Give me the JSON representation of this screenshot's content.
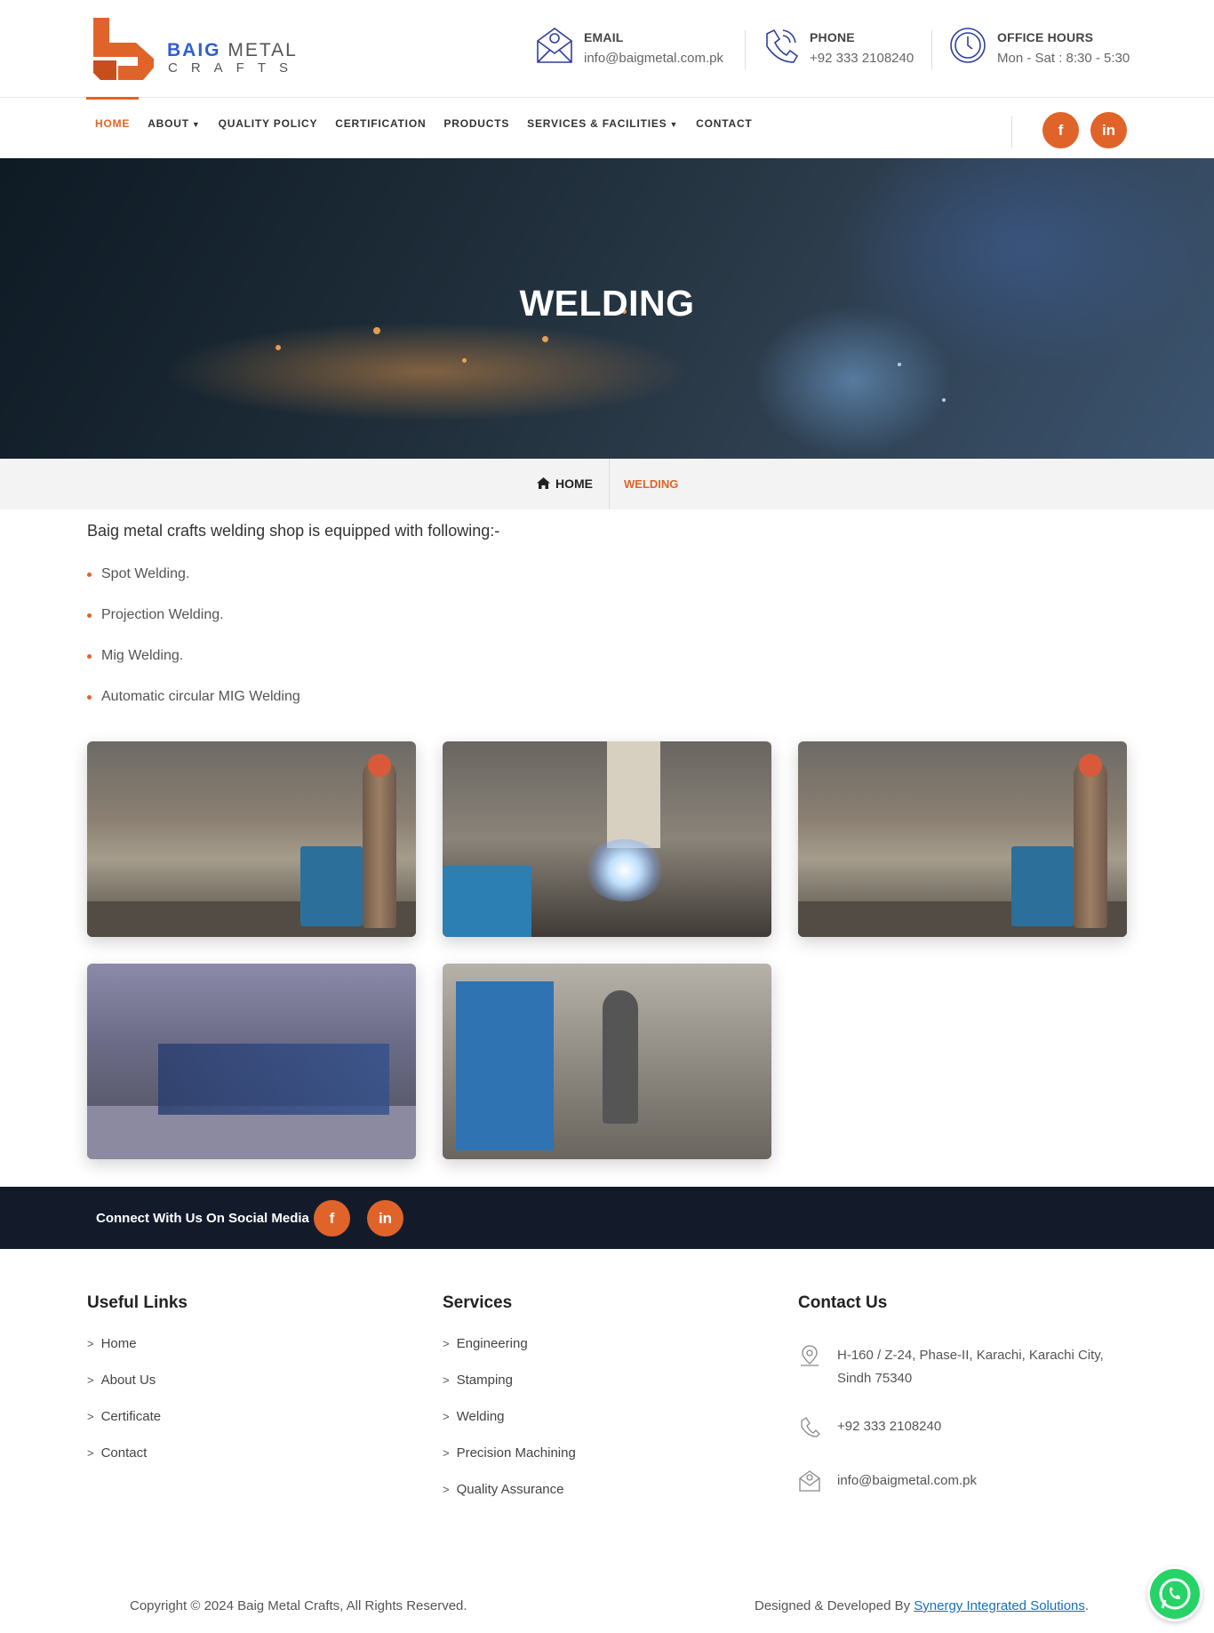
{
  "brand": {
    "word1a": "BAIG",
    "word1b": " METAL",
    "word2": "CRAFTS",
    "accent": "#e0642a",
    "blue": "#2f5fd0",
    "logo_icon": "logo-mark"
  },
  "header": {
    "email": {
      "label": "EMAIL",
      "value": "info@baigmetal.com.pk",
      "icon": "email-icon"
    },
    "phone": {
      "label": "PHONE",
      "value": "+92 333 2108240",
      "icon": "phone-icon"
    },
    "hours": {
      "label": "OFFICE HOURS",
      "value": "Mon - Sat : 8:30 - 5:30",
      "icon": "clock-icon"
    }
  },
  "nav": {
    "items": [
      {
        "label": "HOME",
        "active": true
      },
      {
        "label": "ABOUT",
        "caret": true
      },
      {
        "label": "QUALITY POLICY"
      },
      {
        "label": "CERTIFICATION"
      },
      {
        "label": "PRODUCTS"
      },
      {
        "label": "SERVICES & FACILITIES",
        "caret": true
      },
      {
        "label": "CONTACT"
      }
    ],
    "social": {
      "facebook": "f",
      "linkedin": "in"
    }
  },
  "hero": {
    "title": "WELDING"
  },
  "breadcrumb": {
    "home": "HOME",
    "current": "WELDING"
  },
  "content": {
    "intro": "Baig metal crafts welding shop is equipped with following:-",
    "bullets": [
      "Spot Welding.",
      "Projection Welding.",
      "Mig Welding.",
      "Automatic circular MIG Welding"
    ]
  },
  "social_strip": {
    "text": "Connect With Us On Social Media",
    "facebook": "f",
    "linkedin": "in"
  },
  "footer": {
    "useful_links": {
      "title": "Useful Links",
      "items": [
        "Home",
        "About Us",
        "Certificate",
        "Contact"
      ]
    },
    "services": {
      "title": "Services",
      "items": [
        "Engineering",
        "Stamping",
        "Welding",
        "Precision Machining",
        "Quality Assurance"
      ]
    },
    "contact": {
      "title": "Contact Us",
      "address": "H-160 / Z-24, Phase-II, Karachi, Karachi City, Sindh 75340",
      "phone": "+92 333 2108240",
      "email": "info@baigmetal.com.pk"
    },
    "copyright": "Copyright © 2024 Baig Metal Crafts, All Rights Reserved.",
    "designed_prefix": "Designed & Developed By ",
    "designed_link": "Synergy Integrated Solutions",
    "designed_suffix": "."
  }
}
